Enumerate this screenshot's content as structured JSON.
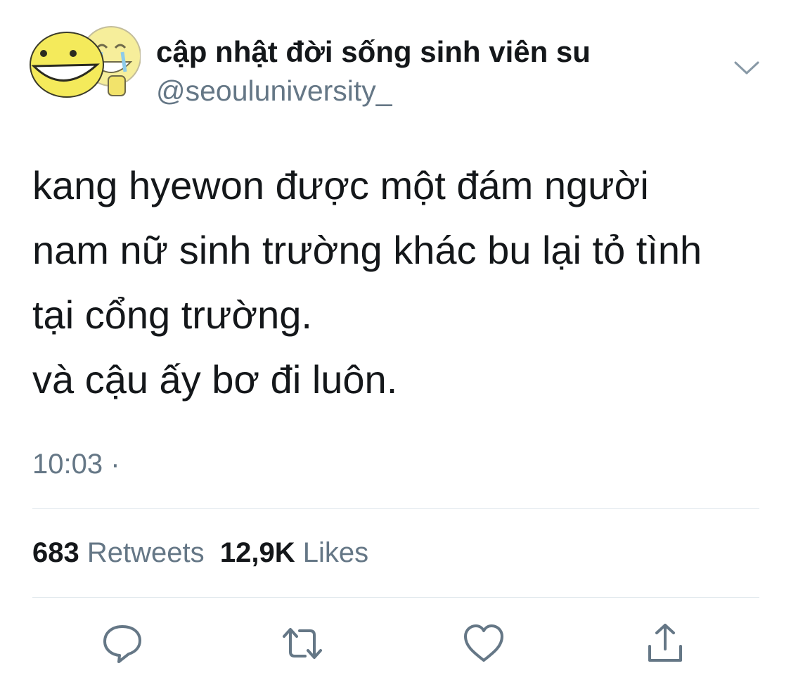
{
  "account": {
    "display_name": "cập nhật đời sống sinh viên su",
    "handle": "@seouluniversity_"
  },
  "tweet": {
    "lines": [
      "kang hyewon được một đám người",
      "nam nữ sinh trường khác bu lại tỏ tình",
      "tại cổng trường.",
      "và cậu ấy bơ đi luôn."
    ],
    "timestamp": "10:03 ·"
  },
  "stats": {
    "retweets_count": "683",
    "retweets_label": "Retweets",
    "likes_count": "12,9K",
    "likes_label": "Likes"
  },
  "icons": {
    "avatar": "laughing-emoji-avatar",
    "menu": "chevron-down-icon",
    "reply": "reply-icon",
    "retweet": "retweet-icon",
    "like": "heart-icon",
    "share": "share-icon"
  },
  "colors": {
    "text": "#14171a",
    "secondary": "#657786",
    "divider": "#e1e8ed",
    "avatar_yellow": "#f5e86a"
  }
}
